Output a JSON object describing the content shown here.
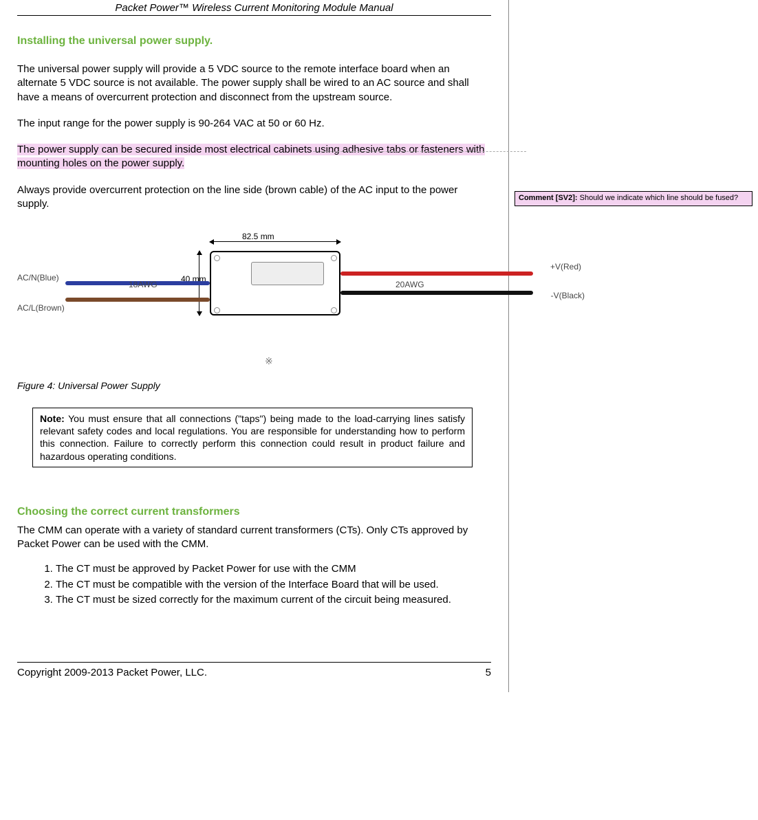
{
  "header": {
    "title": "Packet Power™ Wireless Current Monitoring Module Manual"
  },
  "section1": {
    "title": "Installing the universal power supply.",
    "p1": "The universal power supply will provide a 5 VDC source to the remote interface board when an alternate 5 VDC source is not available.  The power supply shall be wired to an AC source and shall have a means of overcurrent protection and disconnect from the upstream source.",
    "p2": "The input range for the power supply is 90-264 VAC at 50 or 60 Hz.",
    "p3_highlight": "The power supply can be secured inside most electrical cabinets using adhesive tabs or fasteners with mounting holes on the power supply.",
    "p4": "Always provide overcurrent protection on the line side (brown cable) of the AC input to the power supply."
  },
  "figure": {
    "width_label": "82.5 mm",
    "height_label": "40 mm",
    "awg_in": "18AWG",
    "awg_out": "20AWG",
    "acn": "AC/N(Blue)",
    "acl": "AC/L(Brown)",
    "vpos": "+V(Red)",
    "vneg": "-V(Black)",
    "caption": "Figure 4: Universal Power Supply"
  },
  "note": {
    "label": "Note:",
    "body": " You must ensure that all connections (\"taps\") being made to the load-carrying lines satisfy relevant safety codes and local regulations. You are responsible for understanding how to perform this connection.  Failure to correctly perform this connection could result in product failure and hazardous operating conditions."
  },
  "section2": {
    "title": "Choosing the correct current transformers",
    "intro": "The CMM can operate with a variety of standard current transformers (CTs). Only CTs approved by Packet Power can be used with the CMM.",
    "items": [
      "The CT must be approved by Packet Power for use with the CMM",
      "The CT must be compatible with the version of the Interface Board that will be used.",
      "The CT must be sized correctly for the maximum current of the circuit being measured."
    ]
  },
  "comment": {
    "label": "Comment [SV2]:",
    "text": " Should we indicate which line should be fused?"
  },
  "footer": {
    "copyright": "Copyright 2009-2013 Packet Power, LLC.",
    "page": "5"
  }
}
